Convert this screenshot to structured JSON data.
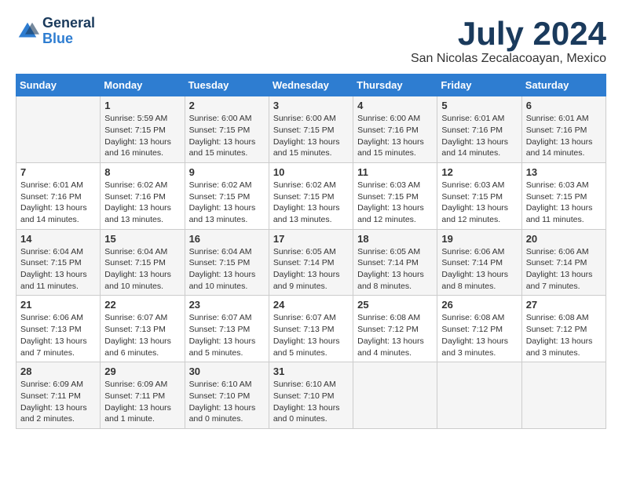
{
  "logo": {
    "line1": "General",
    "line2": "Blue"
  },
  "title": "July 2024",
  "location": "San Nicolas Zecalacoayan, Mexico",
  "weekdays": [
    "Sunday",
    "Monday",
    "Tuesday",
    "Wednesday",
    "Thursday",
    "Friday",
    "Saturday"
  ],
  "weeks": [
    [
      {
        "day": "",
        "sunrise": "",
        "sunset": "",
        "daylight": ""
      },
      {
        "day": "1",
        "sunrise": "Sunrise: 5:59 AM",
        "sunset": "Sunset: 7:15 PM",
        "daylight": "Daylight: 13 hours and 16 minutes."
      },
      {
        "day": "2",
        "sunrise": "Sunrise: 6:00 AM",
        "sunset": "Sunset: 7:15 PM",
        "daylight": "Daylight: 13 hours and 15 minutes."
      },
      {
        "day": "3",
        "sunrise": "Sunrise: 6:00 AM",
        "sunset": "Sunset: 7:15 PM",
        "daylight": "Daylight: 13 hours and 15 minutes."
      },
      {
        "day": "4",
        "sunrise": "Sunrise: 6:00 AM",
        "sunset": "Sunset: 7:16 PM",
        "daylight": "Daylight: 13 hours and 15 minutes."
      },
      {
        "day": "5",
        "sunrise": "Sunrise: 6:01 AM",
        "sunset": "Sunset: 7:16 PM",
        "daylight": "Daylight: 13 hours and 14 minutes."
      },
      {
        "day": "6",
        "sunrise": "Sunrise: 6:01 AM",
        "sunset": "Sunset: 7:16 PM",
        "daylight": "Daylight: 13 hours and 14 minutes."
      }
    ],
    [
      {
        "day": "7",
        "sunrise": "Sunrise: 6:01 AM",
        "sunset": "Sunset: 7:16 PM",
        "daylight": "Daylight: 13 hours and 14 minutes."
      },
      {
        "day": "8",
        "sunrise": "Sunrise: 6:02 AM",
        "sunset": "Sunset: 7:16 PM",
        "daylight": "Daylight: 13 hours and 13 minutes."
      },
      {
        "day": "9",
        "sunrise": "Sunrise: 6:02 AM",
        "sunset": "Sunset: 7:15 PM",
        "daylight": "Daylight: 13 hours and 13 minutes."
      },
      {
        "day": "10",
        "sunrise": "Sunrise: 6:02 AM",
        "sunset": "Sunset: 7:15 PM",
        "daylight": "Daylight: 13 hours and 13 minutes."
      },
      {
        "day": "11",
        "sunrise": "Sunrise: 6:03 AM",
        "sunset": "Sunset: 7:15 PM",
        "daylight": "Daylight: 13 hours and 12 minutes."
      },
      {
        "day": "12",
        "sunrise": "Sunrise: 6:03 AM",
        "sunset": "Sunset: 7:15 PM",
        "daylight": "Daylight: 13 hours and 12 minutes."
      },
      {
        "day": "13",
        "sunrise": "Sunrise: 6:03 AM",
        "sunset": "Sunset: 7:15 PM",
        "daylight": "Daylight: 13 hours and 11 minutes."
      }
    ],
    [
      {
        "day": "14",
        "sunrise": "Sunrise: 6:04 AM",
        "sunset": "Sunset: 7:15 PM",
        "daylight": "Daylight: 13 hours and 11 minutes."
      },
      {
        "day": "15",
        "sunrise": "Sunrise: 6:04 AM",
        "sunset": "Sunset: 7:15 PM",
        "daylight": "Daylight: 13 hours and 10 minutes."
      },
      {
        "day": "16",
        "sunrise": "Sunrise: 6:04 AM",
        "sunset": "Sunset: 7:15 PM",
        "daylight": "Daylight: 13 hours and 10 minutes."
      },
      {
        "day": "17",
        "sunrise": "Sunrise: 6:05 AM",
        "sunset": "Sunset: 7:14 PM",
        "daylight": "Daylight: 13 hours and 9 minutes."
      },
      {
        "day": "18",
        "sunrise": "Sunrise: 6:05 AM",
        "sunset": "Sunset: 7:14 PM",
        "daylight": "Daylight: 13 hours and 8 minutes."
      },
      {
        "day": "19",
        "sunrise": "Sunrise: 6:06 AM",
        "sunset": "Sunset: 7:14 PM",
        "daylight": "Daylight: 13 hours and 8 minutes."
      },
      {
        "day": "20",
        "sunrise": "Sunrise: 6:06 AM",
        "sunset": "Sunset: 7:14 PM",
        "daylight": "Daylight: 13 hours and 7 minutes."
      }
    ],
    [
      {
        "day": "21",
        "sunrise": "Sunrise: 6:06 AM",
        "sunset": "Sunset: 7:13 PM",
        "daylight": "Daylight: 13 hours and 7 minutes."
      },
      {
        "day": "22",
        "sunrise": "Sunrise: 6:07 AM",
        "sunset": "Sunset: 7:13 PM",
        "daylight": "Daylight: 13 hours and 6 minutes."
      },
      {
        "day": "23",
        "sunrise": "Sunrise: 6:07 AM",
        "sunset": "Sunset: 7:13 PM",
        "daylight": "Daylight: 13 hours and 5 minutes."
      },
      {
        "day": "24",
        "sunrise": "Sunrise: 6:07 AM",
        "sunset": "Sunset: 7:13 PM",
        "daylight": "Daylight: 13 hours and 5 minutes."
      },
      {
        "day": "25",
        "sunrise": "Sunrise: 6:08 AM",
        "sunset": "Sunset: 7:12 PM",
        "daylight": "Daylight: 13 hours and 4 minutes."
      },
      {
        "day": "26",
        "sunrise": "Sunrise: 6:08 AM",
        "sunset": "Sunset: 7:12 PM",
        "daylight": "Daylight: 13 hours and 3 minutes."
      },
      {
        "day": "27",
        "sunrise": "Sunrise: 6:08 AM",
        "sunset": "Sunset: 7:12 PM",
        "daylight": "Daylight: 13 hours and 3 minutes."
      }
    ],
    [
      {
        "day": "28",
        "sunrise": "Sunrise: 6:09 AM",
        "sunset": "Sunset: 7:11 PM",
        "daylight": "Daylight: 13 hours and 2 minutes."
      },
      {
        "day": "29",
        "sunrise": "Sunrise: 6:09 AM",
        "sunset": "Sunset: 7:11 PM",
        "daylight": "Daylight: 13 hours and 1 minute."
      },
      {
        "day": "30",
        "sunrise": "Sunrise: 6:10 AM",
        "sunset": "Sunset: 7:10 PM",
        "daylight": "Daylight: 13 hours and 0 minutes."
      },
      {
        "day": "31",
        "sunrise": "Sunrise: 6:10 AM",
        "sunset": "Sunset: 7:10 PM",
        "daylight": "Daylight: 13 hours and 0 minutes."
      },
      {
        "day": "",
        "sunrise": "",
        "sunset": "",
        "daylight": ""
      },
      {
        "day": "",
        "sunrise": "",
        "sunset": "",
        "daylight": ""
      },
      {
        "day": "",
        "sunrise": "",
        "sunset": "",
        "daylight": ""
      }
    ]
  ]
}
